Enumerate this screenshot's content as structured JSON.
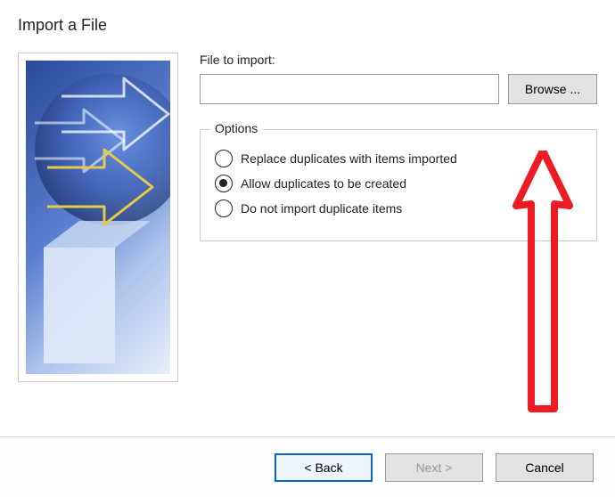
{
  "title": "Import a File",
  "file": {
    "label": "File to import:",
    "value": "",
    "placeholder": "",
    "browse_label": "Browse ..."
  },
  "options": {
    "legend": "Options",
    "radios": [
      {
        "label": "Replace duplicates with items imported",
        "checked": false
      },
      {
        "label": "Allow duplicates to be created",
        "checked": true
      },
      {
        "label": "Do not import duplicate items",
        "checked": false
      }
    ]
  },
  "buttons": {
    "back": "< Back",
    "next": "Next >",
    "cancel": "Cancel"
  },
  "annotation": {
    "color": "#ed1c24",
    "points_to": "browse-button"
  }
}
